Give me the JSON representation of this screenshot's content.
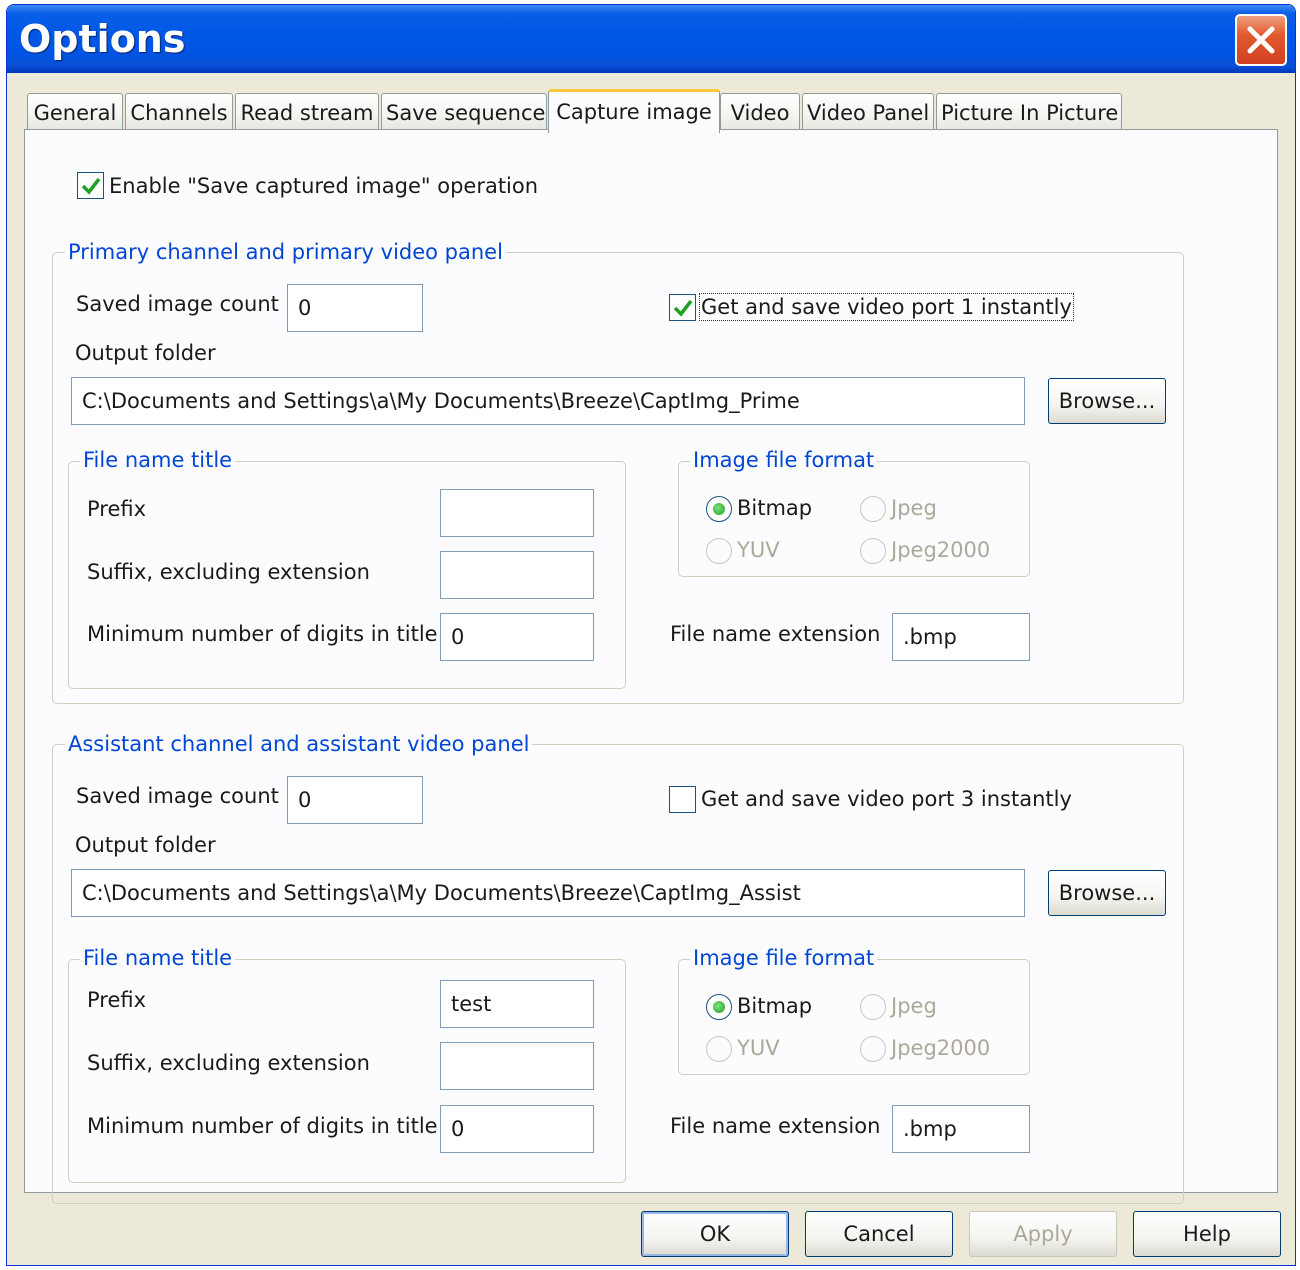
{
  "window": {
    "title": "Options"
  },
  "tabs": [
    {
      "label": "General"
    },
    {
      "label": "Channels"
    },
    {
      "label": "Read stream"
    },
    {
      "label": "Save sequence"
    },
    {
      "label": "Capture image"
    },
    {
      "label": "Video"
    },
    {
      "label": "Video Panel"
    },
    {
      "label": "Picture In Picture"
    }
  ],
  "active_tab": "Capture image",
  "enable_save": {
    "label": "Enable \"Save captured image\" operation",
    "checked": true
  },
  "primary": {
    "group_title": "Primary channel and primary video panel",
    "saved_count_label": "Saved image count",
    "saved_count_value": "0",
    "instant_label": "Get and save video port 1 instantly",
    "instant_checked": true,
    "output_folder_label": "Output folder",
    "output_folder_value": "C:\\Documents and Settings\\a\\My Documents\\Breeze\\CaptImg_Prime",
    "browse_label": "Browse...",
    "file_name_title": "File name title",
    "prefix_label": "Prefix",
    "prefix_value": "",
    "suffix_label": "Suffix, excluding extension",
    "suffix_value": "",
    "min_digits_label": "Minimum number of digits in title",
    "min_digits_value": "0",
    "image_format_title": "Image file format",
    "format_bitmap": "Bitmap",
    "format_jpeg": "Jpeg",
    "format_yuv": "YUV",
    "format_jpeg2000": "Jpeg2000",
    "selected_format": "Bitmap",
    "extension_label": "File name extension",
    "extension_value": ".bmp"
  },
  "assistant": {
    "group_title": "Assistant channel and assistant video panel",
    "saved_count_label": "Saved image count",
    "saved_count_value": "0",
    "instant_label": "Get and save video port 3 instantly",
    "instant_checked": false,
    "output_folder_label": "Output folder",
    "output_folder_value": "C:\\Documents and Settings\\a\\My Documents\\Breeze\\CaptImg_Assist",
    "browse_label": "Browse...",
    "file_name_title": "File name title",
    "prefix_label": "Prefix",
    "prefix_value": "test",
    "suffix_label": "Suffix, excluding extension",
    "suffix_value": "",
    "min_digits_label": "Minimum number of digits in title",
    "min_digits_value": "0",
    "image_format_title": "Image file format",
    "format_bitmap": "Bitmap",
    "format_jpeg": "Jpeg",
    "format_yuv": "YUV",
    "format_jpeg2000": "Jpeg2000",
    "selected_format": "Bitmap",
    "extension_label": "File name extension",
    "extension_value": ".bmp"
  },
  "buttons": {
    "ok": "OK",
    "cancel": "Cancel",
    "apply": "Apply",
    "help": "Help"
  },
  "colors": {
    "titlebar": "#0054e3",
    "group_title": "#0046d5",
    "dialog_bg": "#ece9d8",
    "active_tab_accent": "#ffc83c"
  }
}
